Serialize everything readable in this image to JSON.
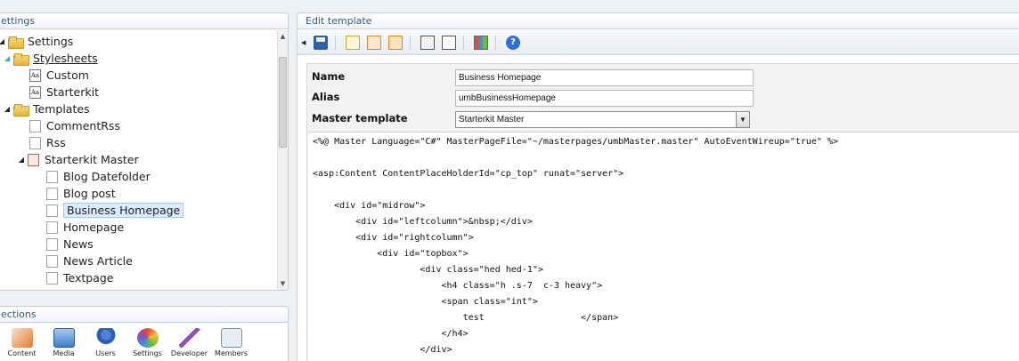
{
  "settings_panel": {
    "title": "ettings",
    "tree": [
      {
        "label": "Settings",
        "icon": "folder"
      },
      {
        "label": "Stylesheets",
        "icon": "folder"
      },
      {
        "label": "Custom",
        "icon": "stylesheet"
      },
      {
        "label": "Starterkit",
        "icon": "stylesheet"
      },
      {
        "label": "Templates",
        "icon": "folder"
      },
      {
        "label": "CommentRss",
        "icon": "template"
      },
      {
        "label": "Rss",
        "icon": "template"
      },
      {
        "label": "Starterkit Master",
        "icon": "master-template"
      },
      {
        "label": "Blog Datefolder",
        "icon": "template"
      },
      {
        "label": "Blog post",
        "icon": "template"
      },
      {
        "label": "Business Homepage",
        "icon": "template"
      },
      {
        "label": "Homepage",
        "icon": "template"
      },
      {
        "label": "News",
        "icon": "template"
      },
      {
        "label": "News Article",
        "icon": "template"
      },
      {
        "label": "Textpage",
        "icon": "template"
      }
    ]
  },
  "sections_panel": {
    "title": "ections",
    "items": [
      {
        "label": "Content",
        "icon": "content-icon",
        "color": "#e07a2f"
      },
      {
        "label": "Media",
        "icon": "media-icon",
        "color": "#3d7cc9"
      },
      {
        "label": "Users",
        "icon": "users-icon",
        "color": "#2f5fb5"
      },
      {
        "label": "Settings",
        "icon": "settings-icon",
        "color": "#6cbf3a"
      },
      {
        "label": "Developer",
        "icon": "developer-icon",
        "color": "#8a4fb8"
      },
      {
        "label": "Members",
        "icon": "members-icon",
        "color": "#7a8fa8"
      }
    ]
  },
  "editor": {
    "title": "Edit template",
    "fields": {
      "name_label": "Name",
      "name_value": "Business Homepage",
      "alias_label": "Alias",
      "alias_value": "umbBusinessHomepage",
      "master_label": "Master template",
      "master_value": "Starterkit Master"
    },
    "code_lines": [
      "<%@ Master Language=\"C#\" MasterPageFile=\"~/masterpages/umbMaster.master\" AutoEventWireup=\"true\" %>",
      "",
      "<asp:Content ContentPlaceHolderId=\"cp_top\" runat=\"server\">",
      "",
      "    <div id=\"midrow\">",
      "        <div id=\"leftcolumn\">&nbsp;</div>",
      "        <div id=\"rightcolumn\">",
      "            <div id=\"topbox\">",
      "                    <div class=\"hed hed-1\">",
      "                        <h4 class=\"h .s-7  c-3 heavy\">",
      "                        <span class=\"int\">",
      "                            test                  </span>",
      "                        </h4>",
      "                    </div>"
    ]
  }
}
